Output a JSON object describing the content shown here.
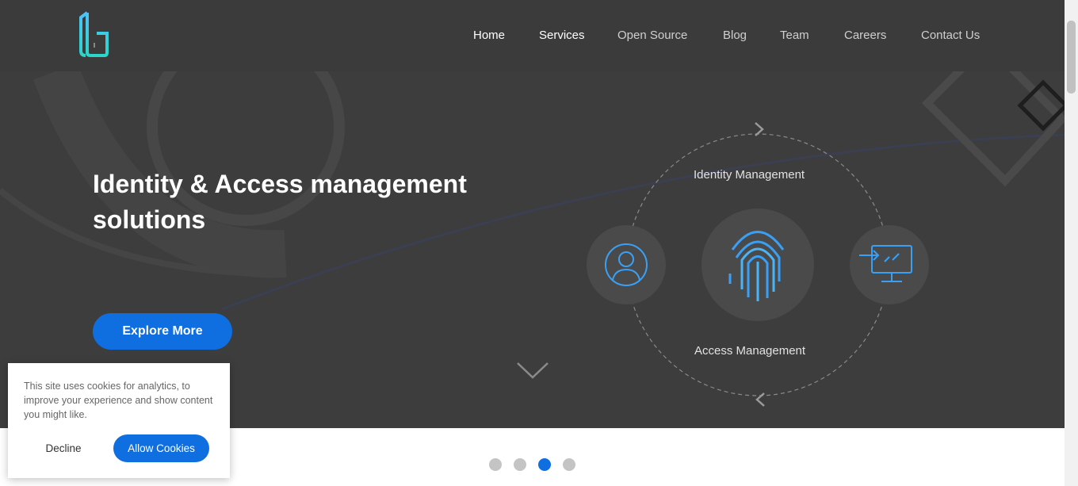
{
  "nav": {
    "items": [
      {
        "label": "Home"
      },
      {
        "label": "Services"
      },
      {
        "label": "Open Source"
      },
      {
        "label": "Blog"
      },
      {
        "label": "Team"
      },
      {
        "label": "Careers"
      },
      {
        "label": "Contact Us"
      }
    ]
  },
  "hero": {
    "headline": "Identity & Access management solutions",
    "cta_label": "Explore More"
  },
  "diagram": {
    "top_label": "Identity Management",
    "bottom_label": "Access Management",
    "icons": [
      "user-icon",
      "fingerprint-icon",
      "monitor-login-icon"
    ]
  },
  "carousel": {
    "slide_count": 4,
    "active_index": 3
  },
  "cookie_banner": {
    "message": "This site uses cookies for analytics, to improve your experience and show content you might like.",
    "decline_label": "Decline",
    "allow_label": "Allow Cookies"
  },
  "colors": {
    "accent": "#0f6fe0",
    "hero_bg": "#3d3d3d",
    "logo_gradient_start": "#4fc3f7",
    "logo_gradient_end": "#2ad6c9"
  }
}
